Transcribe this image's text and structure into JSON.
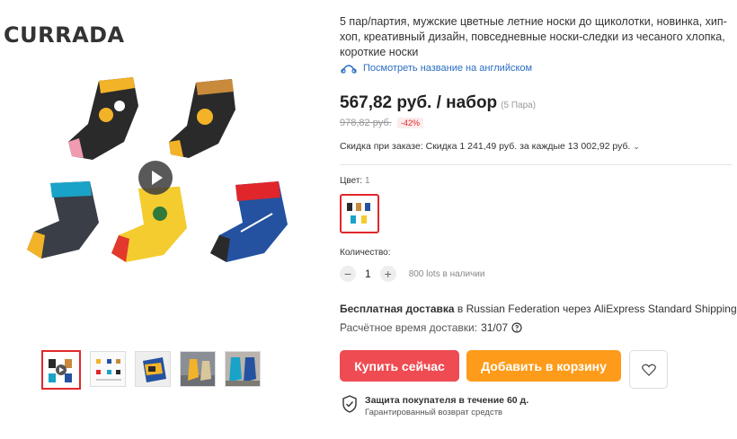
{
  "brand": "CURRADA",
  "product": {
    "title": "5 пар/партия, мужские цветные летние носки до щиколотки, новинка, хип-хоп, креативный дизайн, повседневные носки-следки из чесаного хлопка, короткие носки",
    "translate_link": "Посмотреть название на английском",
    "price": "567,82 руб. / набор",
    "price_unit": "(5 Пара)",
    "old_price": "978,82 руб.",
    "discount_badge": "-42%",
    "order_discount": "Скидка при заказе: Скидка 1 241,49 руб. за каждые 13 002,92 руб.",
    "color_label": "Цвет:",
    "color_value": "1",
    "quantity_label": "Количество:",
    "quantity": "1",
    "minus": "−",
    "plus": "+",
    "availability": "800 lots в наличии",
    "shipping_free": "Бесплатная доставка",
    "shipping_rest": " в Russian Federation через AliExpress Standard Shipping",
    "eta_label": "Расчётное время доставки:",
    "eta_date": "31/07",
    "buy_button": "Купить сейчас",
    "cart_button": "Добавить в корзину",
    "protection_title": "Защита покупателя в течение 60 д.",
    "protection_sub": "Гарантированный возврат средств"
  },
  "icons": {
    "translate": "translate-icon",
    "play": "play-icon",
    "heart": "heart-icon",
    "shield": "shield-check-icon",
    "info": "info-icon",
    "chevron": "chevron-down-icon"
  },
  "colors": {
    "accent": "#e1272c",
    "buy": "#ef4b52",
    "cart": "#fe9b1a",
    "link": "#2b6dc2"
  }
}
